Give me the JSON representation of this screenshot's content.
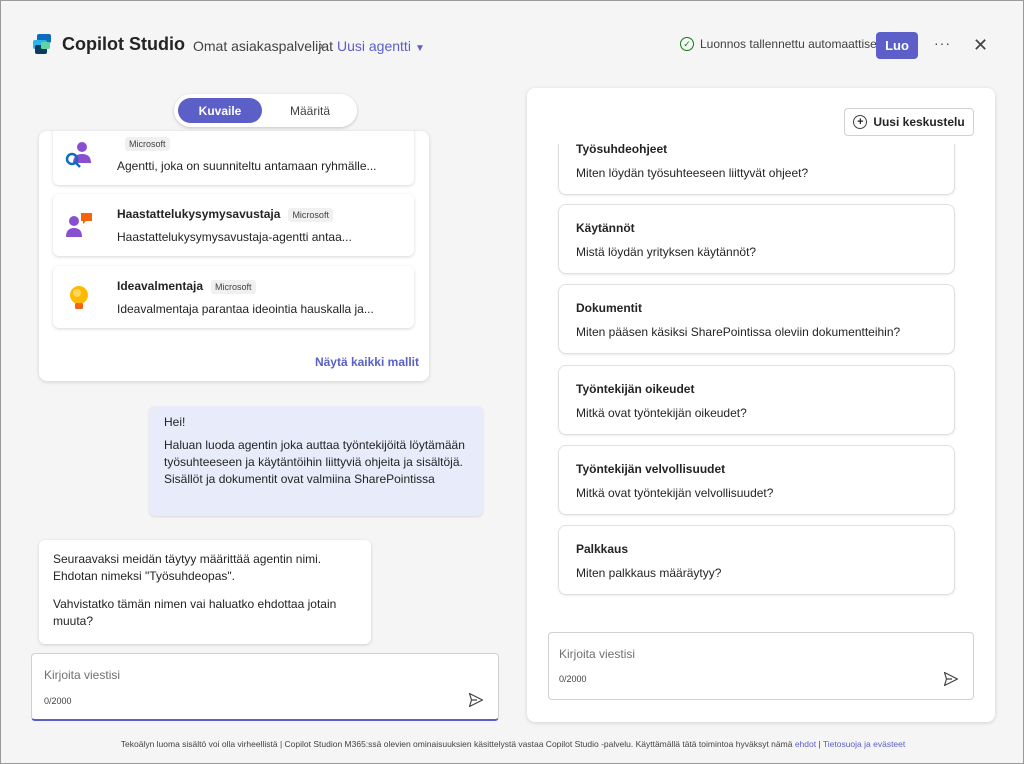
{
  "header": {
    "app_title": "Copilot Studio",
    "breadcrumb": "Omat asiakaspalvelijat",
    "current": "Uusi agentti",
    "saved_status": "Luonnos tallennettu automaattisesti",
    "create_label": "Luo",
    "more_label": "···",
    "close_label": "✕"
  },
  "left": {
    "tabs": [
      {
        "label": "Kuvaile",
        "active": true
      },
      {
        "label": "Määritä",
        "active": false
      }
    ],
    "templates": [
      {
        "name": "",
        "badge": "Microsoft",
        "desc": "Agentti, joka on suunniteltu antamaan ryhmälle..."
      },
      {
        "name": "Haastattelukysymysavustaja",
        "badge": "Microsoft",
        "desc": "Haastattelukysymysavustaja-agentti antaa..."
      },
      {
        "name": "Ideavalmentaja",
        "badge": "Microsoft",
        "desc": "Ideavalmentaja parantaa ideointia hauskalla ja..."
      }
    ],
    "show_all": "Näytä kaikki mallit",
    "user_message": {
      "greeting": "Hei!",
      "body": "Haluan luoda agentin joka auttaa työntekijöitä löytämään työsuhteeseen ja käytäntöihin liittyviä ohjeita ja sisältöjä. Sisällöt ja dokumentit ovat valmiina SharePointissa"
    },
    "bot_message": {
      "p1": "Seuraavaksi meidän täytyy määrittää agentin nimi. Ehdotan nimeksi \"Työsuhdeopas\".",
      "p2": "Vahvistatko tämän nimen vai haluatko ehdottaa jotain muuta?"
    },
    "input": {
      "placeholder": "Kirjoita viestisi",
      "count": "0/2000"
    }
  },
  "right": {
    "new_chat": "Uusi keskustelu",
    "prompts": [
      {
        "title": "Työsuhdeohjeet",
        "question": "Miten löydän työsuhteeseen liittyvät ohjeet?"
      },
      {
        "title": "Käytännöt",
        "question": "Mistä löydän yrityksen käytännöt?"
      },
      {
        "title": "Dokumentit",
        "question": "Miten pääsen käsiksi SharePointissa oleviin dokumentteihin?"
      },
      {
        "title": "Työntekijän oikeudet",
        "question": "Mitkä ovat työntekijän oikeudet?"
      },
      {
        "title": "Työntekijän velvollisuudet",
        "question": "Mitkä ovat työntekijän velvollisuudet?"
      },
      {
        "title": "Palkkaus",
        "question": "Miten palkkaus määräytyy?"
      }
    ],
    "input": {
      "placeholder": "Kirjoita viestisi",
      "count": "0/2000"
    }
  },
  "footer": {
    "text": "Tekoälyn luoma sisältö voi olla virheellistä | Copilot Studion M365:ssä olevien ominaisuuksien käsittelystä vastaa Copilot Studio -palvelu. Käyttämällä tätä toimintoa hyväksyt nämä",
    "link1": "ehdot",
    "sep": " | ",
    "link2": "Tietosuoja ja evästeet"
  },
  "colors": {
    "accent": "#5b5fc7",
    "success": "#107c10",
    "user_bubble": "#e8ebfa"
  }
}
